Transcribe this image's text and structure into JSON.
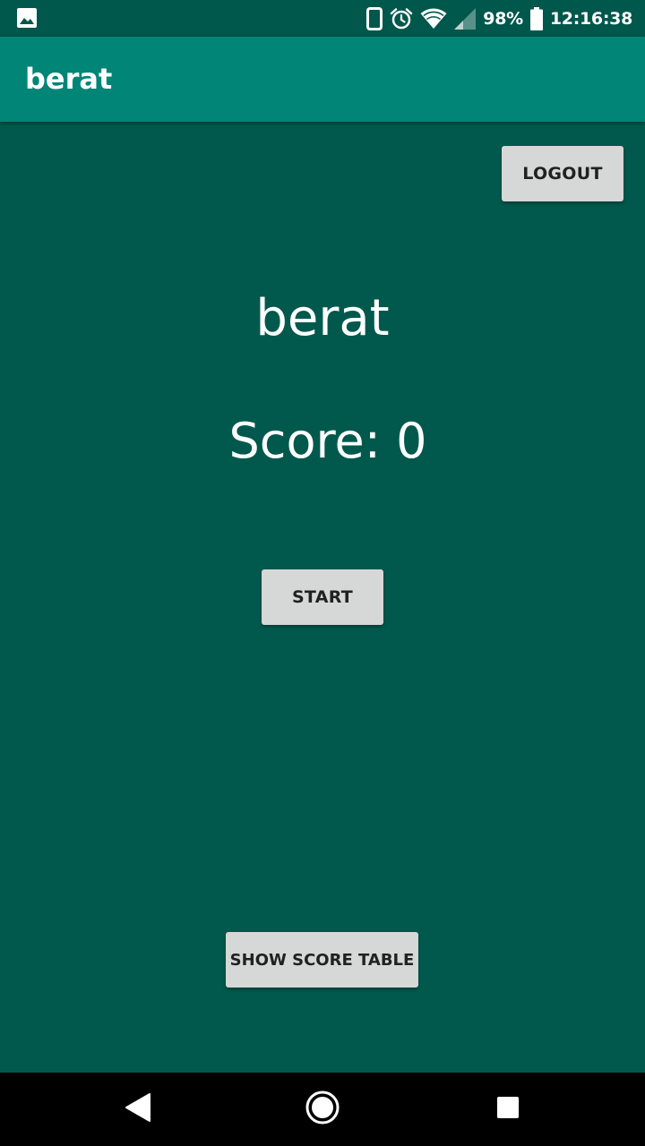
{
  "status_bar": {
    "battery_percent": "98%",
    "time": "12:16:38",
    "icons": [
      "gallery-icon",
      "phone-icon",
      "alarm-icon",
      "wifi-icon",
      "cell-signal-icon",
      "battery-icon"
    ]
  },
  "app_bar": {
    "title": "berat"
  },
  "main": {
    "logout_label": "LOGOUT",
    "username": "berat",
    "score_text": "Score: 0",
    "start_label": "START",
    "show_score_table_label": "SHOW SCORE TABLE"
  },
  "nav_bar": {
    "icons": [
      "back-icon",
      "home-icon",
      "recents-icon"
    ]
  },
  "colors": {
    "status_bar": "#00574b",
    "app_bar": "#008577",
    "background": "#00594c",
    "button": "#d6d7d7",
    "button_text": "#212121",
    "text": "#ffffff"
  }
}
